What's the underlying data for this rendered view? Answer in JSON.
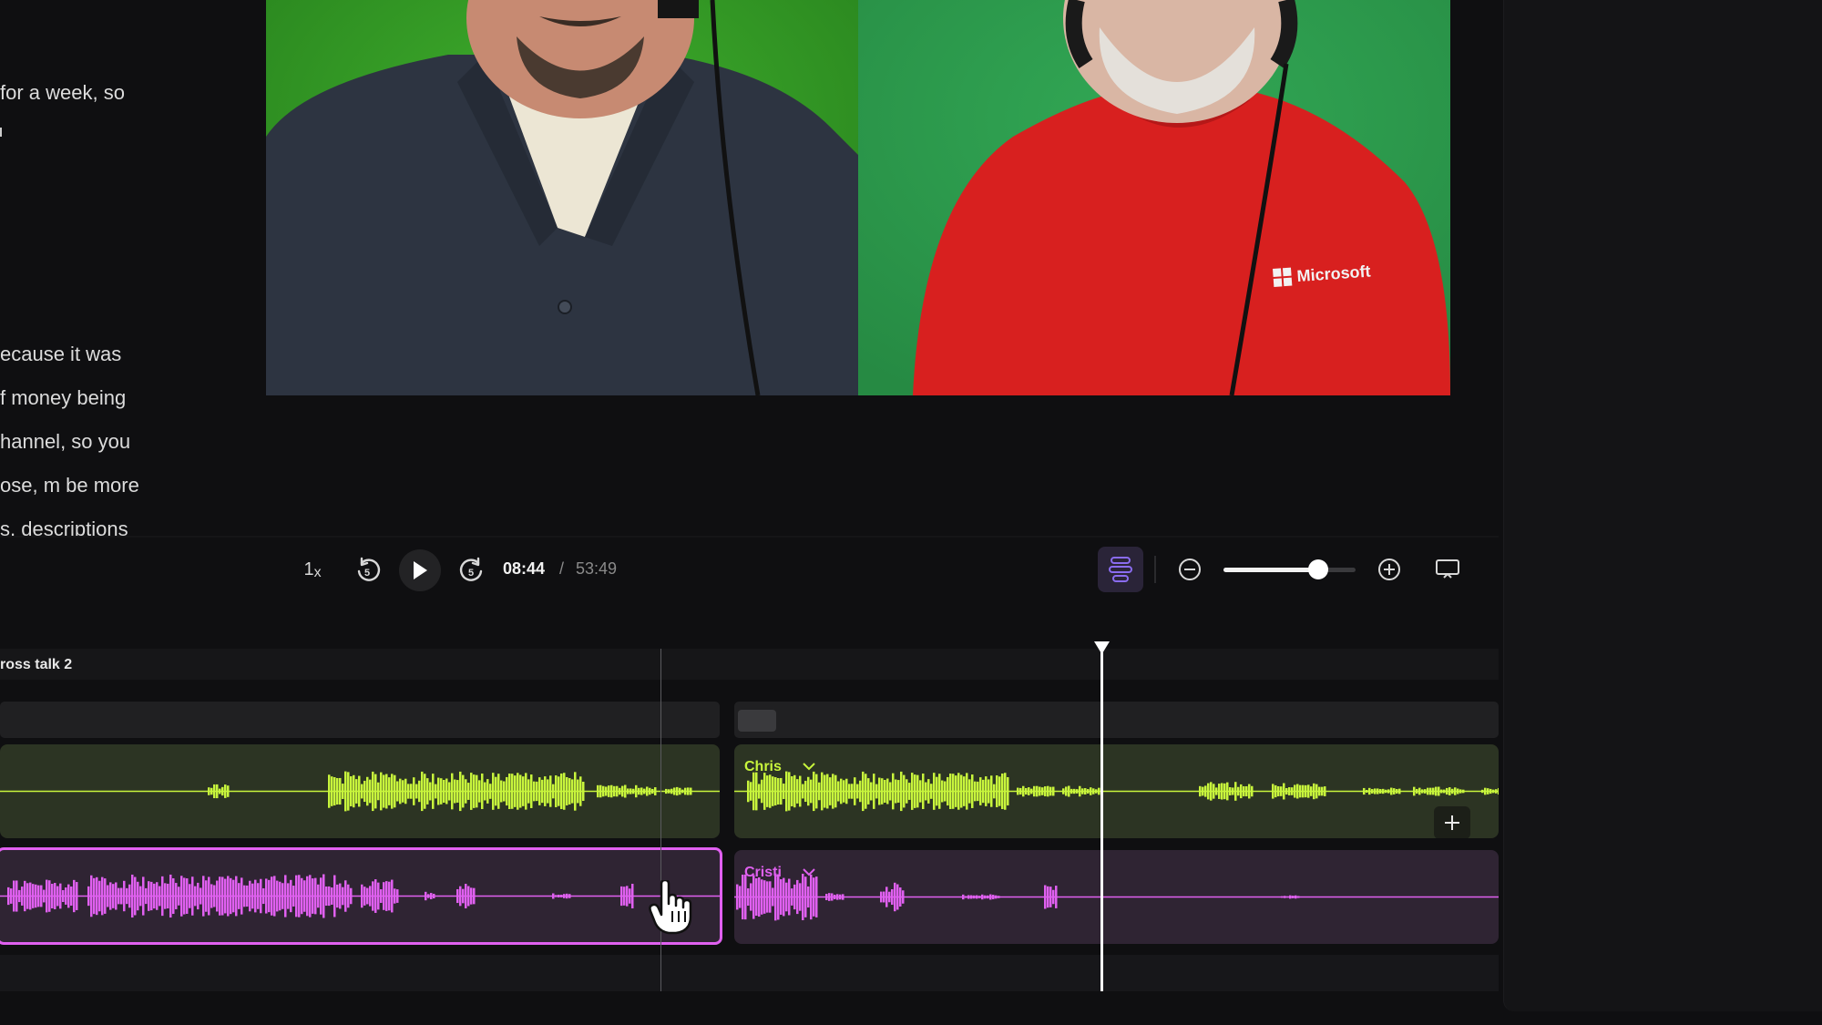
{
  "transcript": {
    "lines": [
      "for a week, so",
      "ecause it was",
      "f money being",
      "hannel, so you",
      "ose, m be more",
      "s, descriptions"
    ]
  },
  "video": {
    "shirt_logo": "Microsoft"
  },
  "player": {
    "speed_value": "1",
    "speed_suffix": "x",
    "current_time": "08:44",
    "separator": "/",
    "total_time": "53:49",
    "rewind_seconds": "5",
    "forward_seconds": "5",
    "zoom_level": 0.72
  },
  "timeline": {
    "scene_label": "ross talk 2",
    "tracks": [
      {
        "speaker": "Chris",
        "color": "#c8f53c"
      },
      {
        "speaker": "Cristi",
        "color": "#e060f0"
      }
    ]
  },
  "colors": {
    "accent_purple": "#8a6cf0",
    "green_wave": "#c8f53c",
    "purple_wave": "#e060f0"
  }
}
